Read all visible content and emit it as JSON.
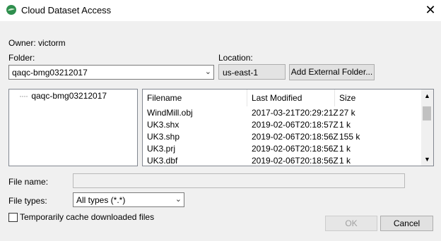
{
  "window": {
    "title": "Cloud Dataset Access",
    "close_glyph": "✕"
  },
  "owner": {
    "label": "Owner:",
    "value": "victorm"
  },
  "folder": {
    "label": "Folder:",
    "value": "qaqc-bmg03212017"
  },
  "location": {
    "label": "Location:",
    "value": "us-east-1"
  },
  "buttons": {
    "add_external": "Add External Folder...",
    "ok": "OK",
    "cancel": "Cancel"
  },
  "tree": {
    "items": [
      {
        "label": "qaqc-bmg03212017"
      }
    ]
  },
  "table": {
    "columns": [
      "Filename",
      "Last Modified",
      "Size"
    ],
    "rows": [
      {
        "filename": "WindMill.obj",
        "modified": "2017-03-21T20:29:21Z",
        "size": "27 k"
      },
      {
        "filename": "UK3.shx",
        "modified": "2019-02-06T20:18:57Z",
        "size": "1 k"
      },
      {
        "filename": "UK3.shp",
        "modified": "2019-02-06T20:18:56Z",
        "size": "155 k"
      },
      {
        "filename": "UK3.prj",
        "modified": "2019-02-06T20:18:56Z",
        "size": "1 k"
      },
      {
        "filename": "UK3.dbf",
        "modified": "2019-02-06T20:18:56Z",
        "size": "1 k"
      }
    ]
  },
  "file_name": {
    "label": "File name:",
    "value": ""
  },
  "file_types": {
    "label": "File types:",
    "value": "All types (*.*)"
  },
  "cache": {
    "label": "Temporarily cache downloaded files",
    "checked": false
  },
  "icons": {
    "app": "globe-app-icon",
    "close": "close-icon",
    "dropdown": "chevron-down-icon"
  }
}
